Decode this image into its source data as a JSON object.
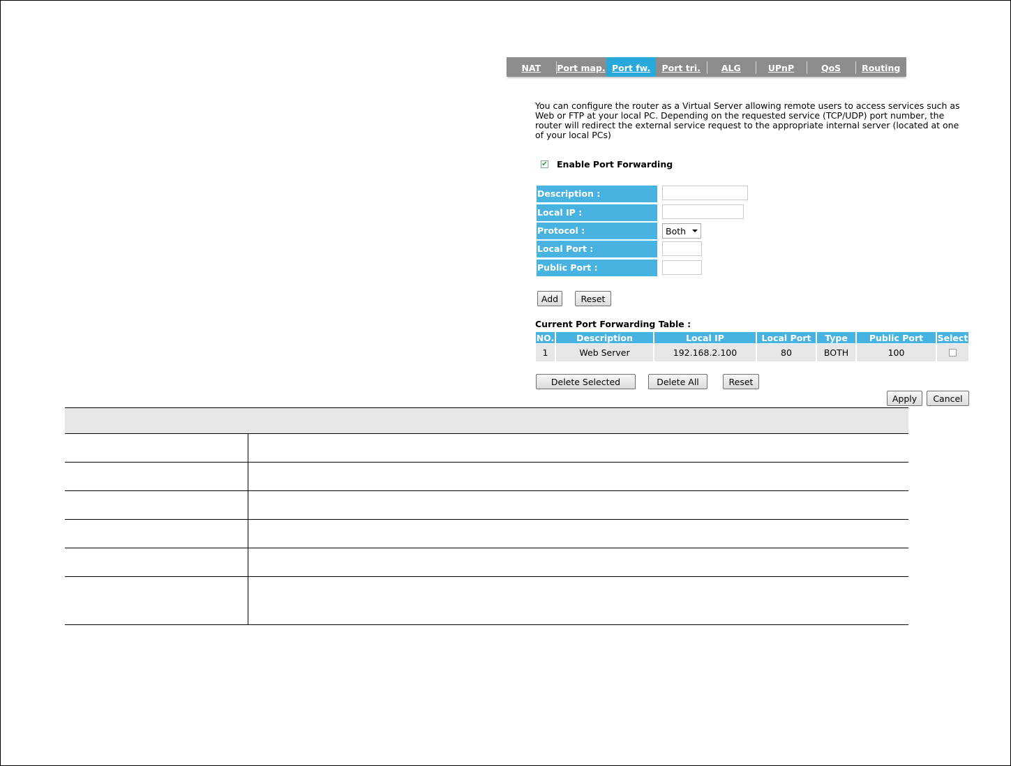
{
  "tabs": [
    {
      "label": "NAT",
      "active": false
    },
    {
      "label": "Port map.",
      "active": false
    },
    {
      "label": "Port fw.",
      "active": true
    },
    {
      "label": "Port tri.",
      "active": false
    },
    {
      "label": "ALG",
      "active": false
    },
    {
      "label": "UPnP",
      "active": false
    },
    {
      "label": "QoS",
      "active": false
    },
    {
      "label": "Routing",
      "active": false
    }
  ],
  "intro": "You can configure the router as a Virtual Server allowing remote users to access services such as Web or FTP at your local PC. Depending on the requested service (TCP/UDP) port number, the router will redirect the external service request to the appropriate internal server (located at one of your local PCs)",
  "enable": {
    "label": "Enable Port Forwarding",
    "checked": true
  },
  "form": {
    "description_label": "Description :",
    "description_value": "",
    "local_ip_label": "Local IP :",
    "local_ip_value": "",
    "protocol_label": "Protocol :",
    "protocol_value": "Both",
    "local_port_label": "Local Port :",
    "local_port_value": "",
    "public_port_label": "Public Port :",
    "public_port_value": ""
  },
  "form_buttons": {
    "add": "Add",
    "reset": "Reset"
  },
  "table": {
    "title": "Current Port Forwarding Table :",
    "columns": [
      "NO.",
      "Description",
      "Local IP",
      "Local Port",
      "Type",
      "Public Port",
      "Select"
    ],
    "rows": [
      {
        "no": "1",
        "description": "Web Server",
        "local_ip": "192.168.2.100",
        "local_port": "80",
        "type": "BOTH",
        "public_port": "100",
        "selected": false
      }
    ]
  },
  "table_buttons": {
    "delete_selected": "Delete Selected",
    "delete_all": "Delete All",
    "reset": "Reset"
  },
  "footer_buttons": {
    "apply": "Apply",
    "cancel": "Cancel"
  },
  "colors": {
    "tab_bar": "#8c8c8c",
    "tab_active": "#29a9db",
    "label_bg": "#48b3e0",
    "row_bg": "#e6e6e6"
  }
}
